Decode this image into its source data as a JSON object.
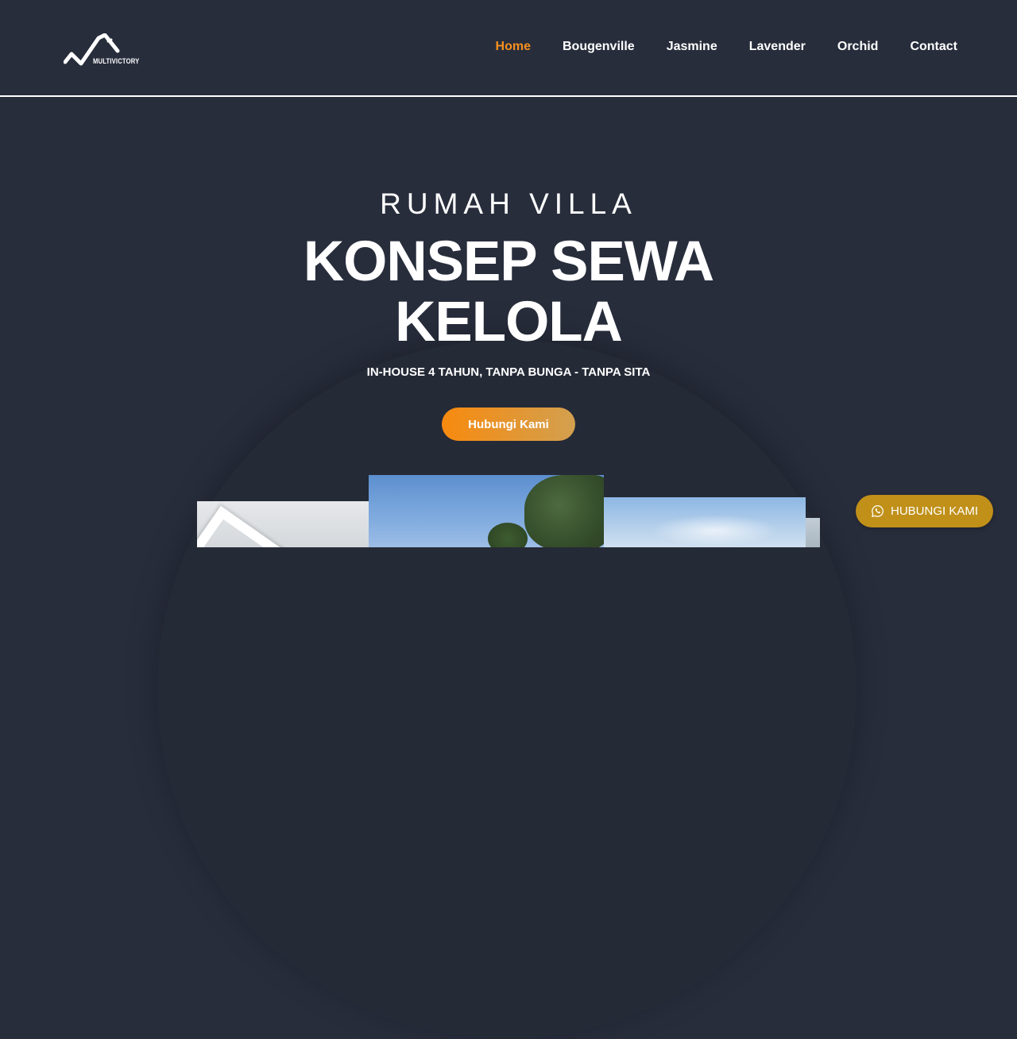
{
  "header": {
    "logo_text": "MULTIVICTORY",
    "nav": [
      {
        "label": "Home",
        "active": true
      },
      {
        "label": "Bougenville",
        "active": false
      },
      {
        "label": "Jasmine",
        "active": false
      },
      {
        "label": "Lavender",
        "active": false
      },
      {
        "label": "Orchid",
        "active": false
      },
      {
        "label": "Contact",
        "active": false
      }
    ]
  },
  "hero": {
    "eyebrow": "RUMAH VILLA",
    "headline": "KONSEP SEWA KELOLA",
    "subline": "IN-HOUSE 4 TAHUN, TANPA BUNGA - TANPA SITA",
    "cta_label": "Hubungi Kami"
  },
  "floating": {
    "whatsapp_label": "HUBUNGI KAMI",
    "icon": "whatsapp-icon"
  },
  "colors": {
    "background": "#282d3c",
    "accent": "#f5901e",
    "cta_start": "#f78a0f",
    "cta_end": "#d3a04f",
    "whatsapp_button": "#c09019"
  }
}
